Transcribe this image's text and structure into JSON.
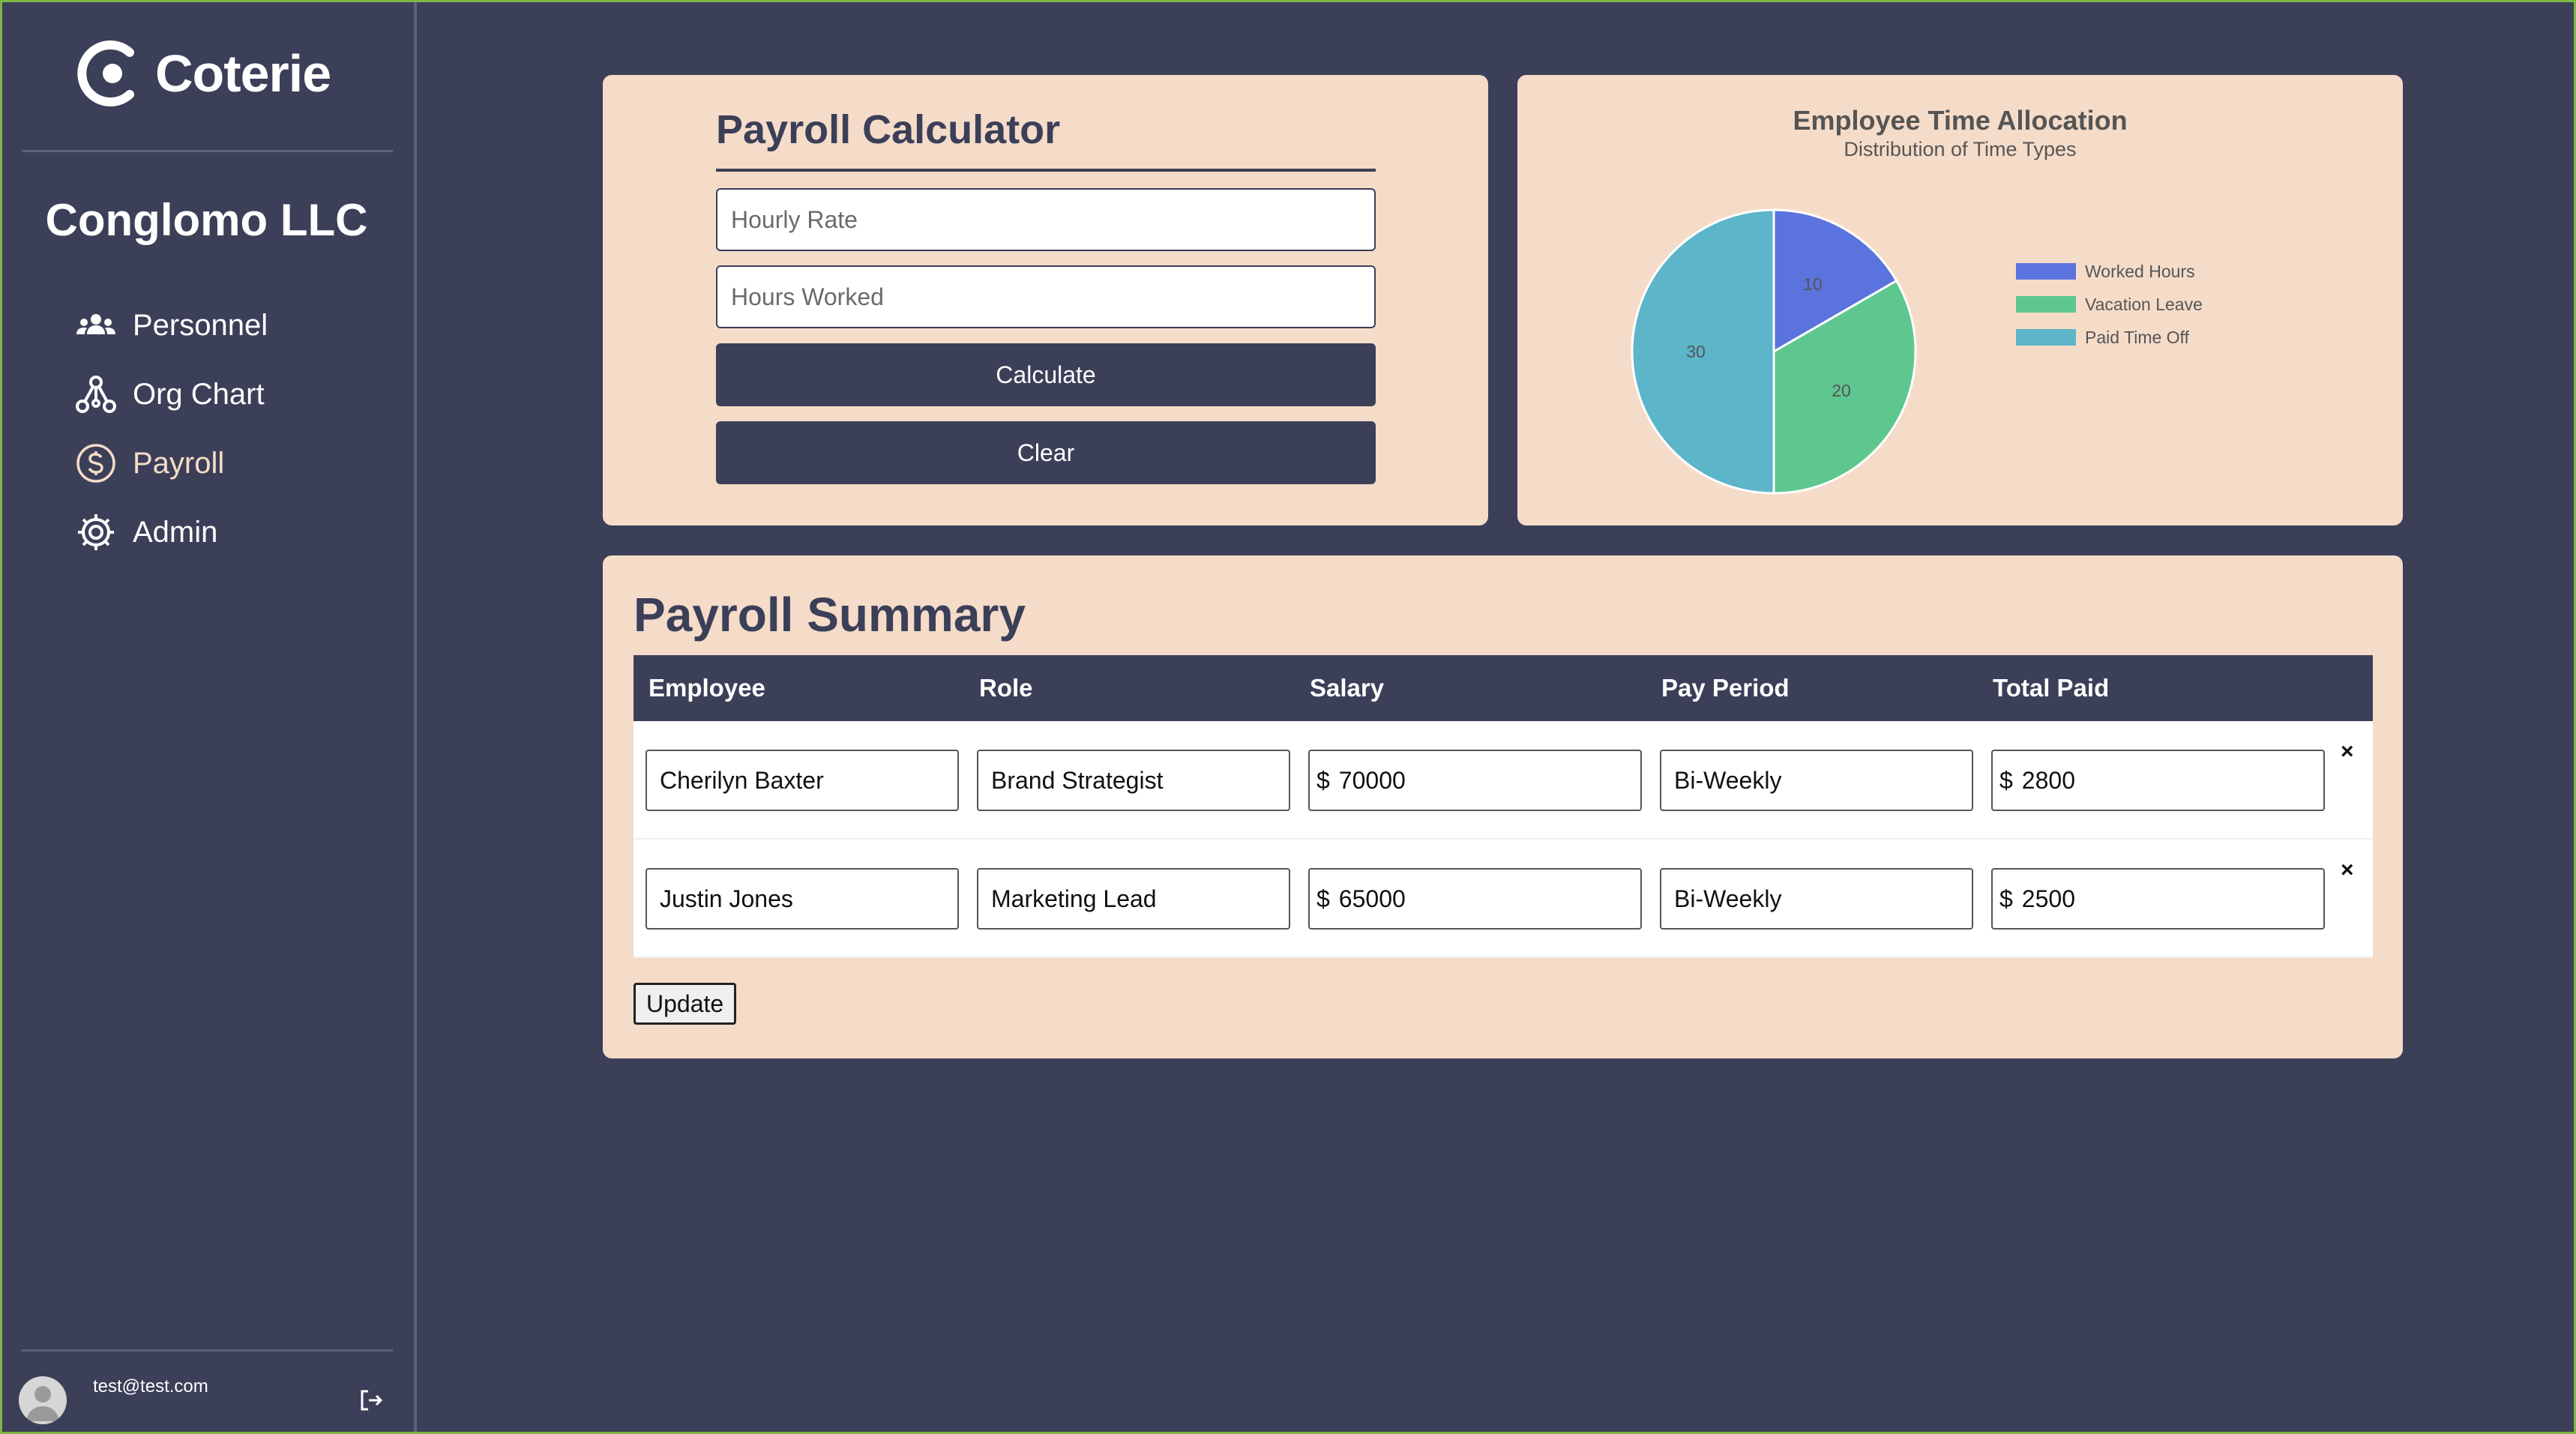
{
  "app": {
    "name": "Coterie",
    "company": "Conglomo LLC"
  },
  "sidebar": {
    "items": [
      {
        "label": "Personnel",
        "icon": "people-icon"
      },
      {
        "label": "Org Chart",
        "icon": "org-chart-icon"
      },
      {
        "label": "Payroll",
        "icon": "dollar-icon",
        "active": true
      },
      {
        "label": "Admin",
        "icon": "gear-icon"
      }
    ],
    "user_email": "test@test.com"
  },
  "calculator": {
    "title": "Payroll Calculator",
    "hourly_placeholder": "Hourly Rate",
    "hours_placeholder": "Hours Worked",
    "calculate_label": "Calculate",
    "clear_label": "Clear"
  },
  "chart_data": {
    "type": "pie",
    "title": "Employee Time Allocation",
    "subtitle": "Distribution of Time Types",
    "legend_position": "right",
    "categories": [
      "Worked Hours",
      "Vacation Leave",
      "Paid Time Off"
    ],
    "values": [
      10,
      20,
      30
    ],
    "colors": [
      "#5b73dc",
      "#5dc78f",
      "#5cb5c9"
    ]
  },
  "summary": {
    "title": "Payroll Summary",
    "columns": [
      "Employee",
      "Role",
      "Salary",
      "Pay Period",
      "Total Paid"
    ],
    "currency_symbol": "$",
    "rows": [
      {
        "employee": "Cherilyn Baxter",
        "role": "Brand Strategist",
        "salary": "70000",
        "pay_period": "Bi-Weekly",
        "total_paid": "2800"
      },
      {
        "employee": "Justin Jones",
        "role": "Marketing Lead",
        "salary": "65000",
        "pay_period": "Bi-Weekly",
        "total_paid": "2500"
      }
    ],
    "delete_glyph": "×",
    "update_label": "Update"
  },
  "colors": {
    "primary": "#3b3f58",
    "card": "#f5dcc9",
    "accent_border": "#7fb546"
  }
}
